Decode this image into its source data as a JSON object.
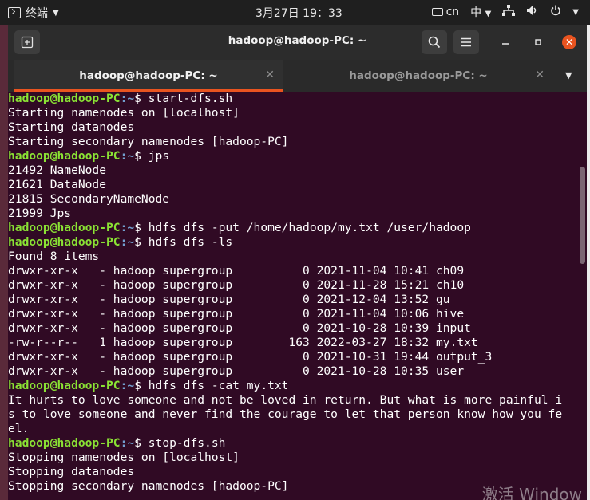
{
  "topbar": {
    "activities_label": "终端",
    "clock": "3月27日  19：33",
    "keyboard_label": "cn",
    "input_method": "中",
    "network_icon": "network-icon",
    "volume_icon": "volume-icon",
    "power_icon": "power-icon"
  },
  "window": {
    "title": "hadoop@hadoop-PC: ~",
    "tabs": [
      {
        "label": "hadoop@hadoop-PC: ~",
        "active": true
      },
      {
        "label": "hadoop@hadoop-PC: ~",
        "active": false
      }
    ]
  },
  "terminal": {
    "prompt_user": "hadoop@hadoop-PC",
    "prompt_path": ":~",
    "prompt_suffix": "$ ",
    "lines": [
      {
        "type": "cmd",
        "text": "start-dfs.sh"
      },
      {
        "type": "out",
        "text": "Starting namenodes on [localhost]"
      },
      {
        "type": "out",
        "text": "Starting datanodes"
      },
      {
        "type": "out",
        "text": "Starting secondary namenodes [hadoop-PC]"
      },
      {
        "type": "cmd",
        "text": "jps"
      },
      {
        "type": "out",
        "text": "21492 NameNode"
      },
      {
        "type": "out",
        "text": "21621 DataNode"
      },
      {
        "type": "out",
        "text": "21815 SecondaryNameNode"
      },
      {
        "type": "out",
        "text": "21999 Jps"
      },
      {
        "type": "cmd",
        "text": "hdfs dfs -put /home/hadoop/my.txt /user/hadoop"
      },
      {
        "type": "cmd",
        "text": "hdfs dfs -ls"
      },
      {
        "type": "out",
        "text": "Found 8 items"
      },
      {
        "type": "out",
        "text": "drwxr-xr-x   - hadoop supergroup          0 2021-11-04 10:41 ch09"
      },
      {
        "type": "out",
        "text": "drwxr-xr-x   - hadoop supergroup          0 2021-11-28 15:21 ch10"
      },
      {
        "type": "out",
        "text": "drwxr-xr-x   - hadoop supergroup          0 2021-12-04 13:52 gu"
      },
      {
        "type": "out",
        "text": "drwxr-xr-x   - hadoop supergroup          0 2021-11-04 10:06 hive"
      },
      {
        "type": "out",
        "text": "drwxr-xr-x   - hadoop supergroup          0 2021-10-28 10:39 input"
      },
      {
        "type": "out",
        "text": "-rw-r--r--   1 hadoop supergroup        163 2022-03-27 18:32 my.txt"
      },
      {
        "type": "out",
        "text": "drwxr-xr-x   - hadoop supergroup          0 2021-10-31 19:44 output_3"
      },
      {
        "type": "out",
        "text": "drwxr-xr-x   - hadoop supergroup          0 2021-10-28 10:35 user"
      },
      {
        "type": "cmd",
        "text": "hdfs dfs -cat my.txt"
      },
      {
        "type": "out",
        "text": "It hurts to love someone and not be loved in return. But what is more painful i"
      },
      {
        "type": "out",
        "text": "s to love someone and never find the courage to let that person know how you fe"
      },
      {
        "type": "out",
        "text": "el."
      },
      {
        "type": "cmd",
        "text": "stop-dfs.sh"
      },
      {
        "type": "out",
        "text": "Stopping namenodes on [localhost]"
      },
      {
        "type": "out",
        "text": "Stopping datanodes"
      },
      {
        "type": "out",
        "text": "Stopping secondary namenodes [hadoop-PC]"
      }
    ]
  },
  "watermark": "激活 Window",
  "colors": {
    "terminal_bg": "#300a24",
    "prompt_user": "#8ae234",
    "prompt_path": "#729fcf",
    "accent": "#e95420"
  }
}
